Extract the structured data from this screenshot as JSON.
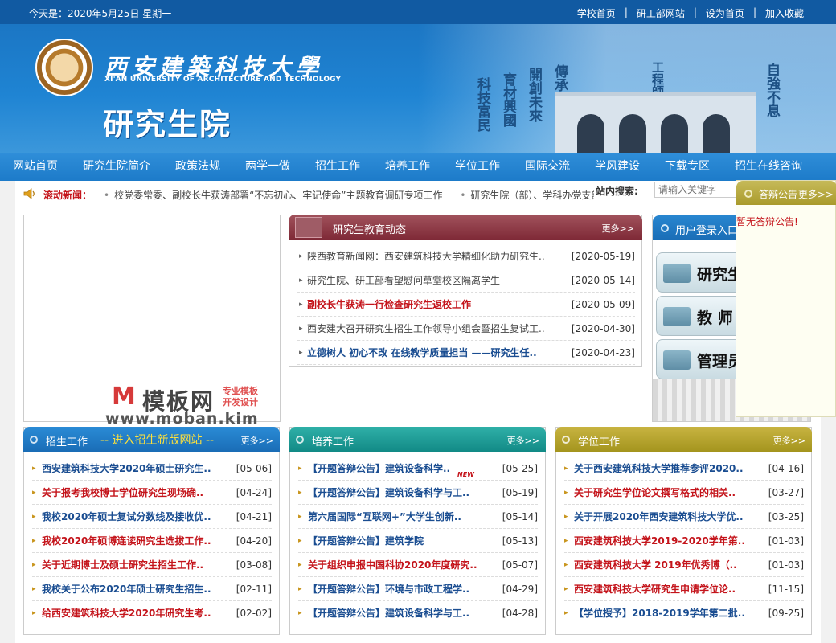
{
  "topbar": {
    "date": "今天是：2020年5月25日 星期一",
    "links": [
      "学校首页",
      "研工部网站",
      "设为首页",
      "加入收藏"
    ],
    "separator": "|"
  },
  "banner": {
    "school_name_cn": "西安建築科技大學",
    "school_name_en": "XI'AN UNIVERSITY OF ARCHITECTURE AND TECHNOLOGY",
    "department": "研究生院",
    "calligraphy": [
      "科技富民",
      "育材興國",
      "開創未來",
      "傳承文明",
      "工程師之搖籃",
      "自強不息"
    ]
  },
  "nav": {
    "items": [
      "网站首页",
      "研究生院简介",
      "政策法规",
      "两学一做",
      "招生工作",
      "培养工作",
      "学位工作",
      "国际交流",
      "学风建设",
      "下载专区",
      "招生在线咨询"
    ]
  },
  "ticker": {
    "label": "滚动新闻：",
    "items": [
      "校党委常委、副校长牛获涛部署“不忘初心、牢记使命”主题教育调研专项工作",
      "研究生院（部）、学科办党支部"
    ]
  },
  "search": {
    "label": "站内搜索:",
    "placeholder": "请输入关键字"
  },
  "watermark": {
    "logo_letter": "M",
    "logo_text": "模板网",
    "tag_line1": "专业模板",
    "tag_line2": "开发设计",
    "url": "www.moban.kim"
  },
  "news": {
    "title": "研究生教育动态",
    "more": "更多>>",
    "items": [
      {
        "title": "陕西教育新闻网：西安建筑科技大学精细化助力研究生..",
        "date": "[2020-05-19]",
        "style": "normal"
      },
      {
        "title": "研究生院、研工部看望慰问草堂校区隔离学生",
        "date": "[2020-05-14]",
        "style": "normal"
      },
      {
        "title": "副校长牛获涛一行检查研究生返校工作",
        "date": "[2020-05-09]",
        "style": "red"
      },
      {
        "title": "西安建大召开研究生招生工作领导小组会暨招生复试工..",
        "date": "[2020-04-30]",
        "style": "normal"
      },
      {
        "title": "立德树人 初心不改 在线教学质量担当 ——研究生任..",
        "date": "[2020-04-23]",
        "style": "blue"
      }
    ]
  },
  "login": {
    "title": "用户登录入口",
    "buttons": [
      "研究生",
      "教 师",
      "管理员"
    ]
  },
  "notice": {
    "title": "答辩公告",
    "more": "更多>>",
    "body": "暂无答辩公告!"
  },
  "panels": [
    {
      "title": "招生工作",
      "promo": "-- 进入招生新版网站 --",
      "more": "更多>>",
      "items": [
        {
          "title": "西安建筑科技大学2020年硕士研究生..",
          "date": "[05-06]",
          "style": "blue",
          "new": ""
        },
        {
          "title": "关于报考我校博士学位研究生现场确..",
          "date": "[04-24]",
          "style": "red",
          "new": ""
        },
        {
          "title": "我校2020年硕士复试分数线及接收优..",
          "date": "[04-21]",
          "style": "blue",
          "new": ""
        },
        {
          "title": "我校2020年硕博连读研究生选拔工作..",
          "date": "[04-20]",
          "style": "red",
          "new": ""
        },
        {
          "title": "关于近期博士及硕士研究生招生工作..",
          "date": "[03-08]",
          "style": "red",
          "new": ""
        },
        {
          "title": "我校关于公布2020年硕士研究生招生..",
          "date": "[02-11]",
          "style": "blue",
          "new": ""
        },
        {
          "title": "给西安建筑科技大学2020年研究生考..",
          "date": "[02-02]",
          "style": "red",
          "new": ""
        }
      ]
    },
    {
      "title": "培养工作",
      "promo": "",
      "more": "更多>>",
      "items": [
        {
          "title": "【开题答辩公告】建筑设备科学..",
          "date": "[05-25]",
          "style": "blue",
          "new": "NEW"
        },
        {
          "title": "【开题答辩公告】建筑设备科学与工..",
          "date": "[05-19]",
          "style": "blue",
          "new": ""
        },
        {
          "title": "第六届国际“互联网+”大学生创新..",
          "date": "[05-14]",
          "style": "blue",
          "new": ""
        },
        {
          "title": "【开题答辩公告】建筑学院",
          "date": "[05-13]",
          "style": "blue",
          "new": ""
        },
        {
          "title": "关于组织申报中国科协2020年度研究..",
          "date": "[05-07]",
          "style": "red",
          "new": ""
        },
        {
          "title": "【开题答辩公告】环境与市政工程学..",
          "date": "[04-29]",
          "style": "blue",
          "new": ""
        },
        {
          "title": "【开题答辩公告】建筑设备科学与工..",
          "date": "[04-28]",
          "style": "blue",
          "new": ""
        }
      ]
    },
    {
      "title": "学位工作",
      "promo": "",
      "more": "更多>>",
      "items": [
        {
          "title": "关于西安建筑科技大学推荐参评2020..",
          "date": "[04-16]",
          "style": "blue",
          "new": ""
        },
        {
          "title": "关于研究生学位论文撰写格式的相关..",
          "date": "[03-27]",
          "style": "red",
          "new": ""
        },
        {
          "title": "关于开展2020年西安建筑科技大学优..",
          "date": "[03-25]",
          "style": "blue",
          "new": ""
        },
        {
          "title": "西安建筑科技大学2019-2020学年第..",
          "date": "[01-03]",
          "style": "red",
          "new": ""
        },
        {
          "title": "西安建筑科技大学 2019年优秀博（..",
          "date": "[01-03]",
          "style": "red",
          "new": ""
        },
        {
          "title": "西安建筑科技大学研究生申请学位论..",
          "date": "[11-15]",
          "style": "red",
          "new": ""
        },
        {
          "title": "【学位授予】2018-2019学年第二批..",
          "date": "[09-25]",
          "style": "blue",
          "new": ""
        }
      ]
    }
  ],
  "colors": {
    "primary_blue": "#115aa2",
    "nav_blue": "#1d7bc9",
    "link_red": "#c4141b",
    "link_blue": "#1a4d91",
    "news_header": "#7f2a37",
    "teal_header": "#128a86",
    "gold_header": "#a4951e"
  }
}
